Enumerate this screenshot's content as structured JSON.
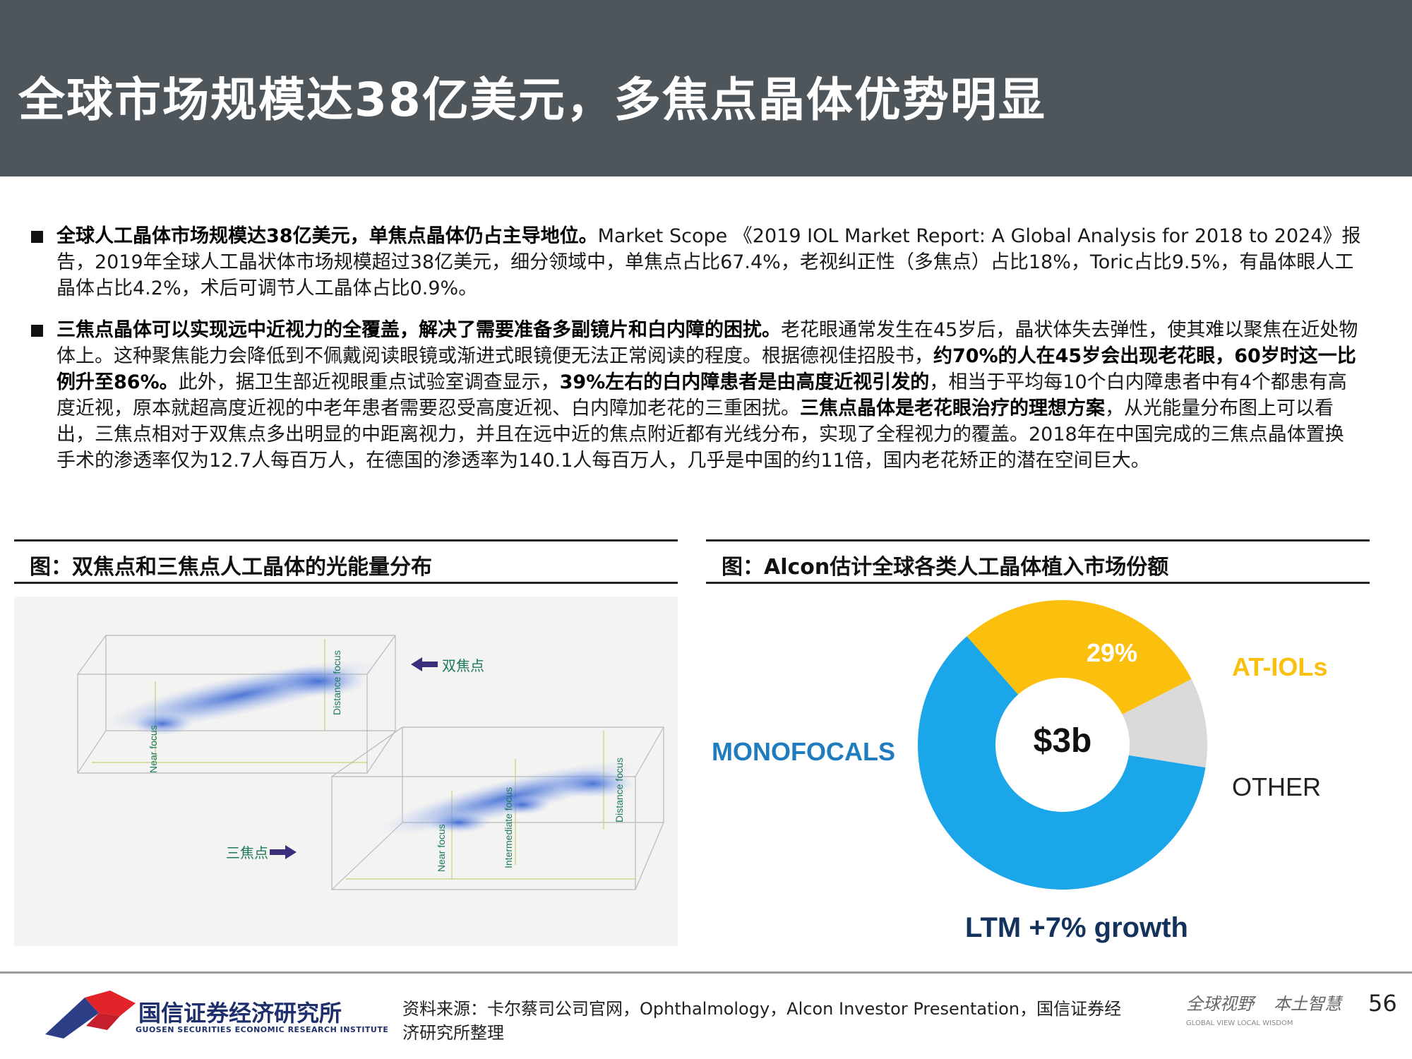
{
  "header": {
    "title": "全球市场规模达38亿美元，多焦点晶体优势明显"
  },
  "bullets": [
    {
      "bold1": "全球人工晶体市场规模达38亿美元，单焦点晶体仍占主导地位。",
      "text1": "Market Scope 《2019 IOL Market Report: A Global Analysis for 2018 to 2024》报告，2019年全球人工晶状体市场规模超过38亿美元，细分领域中，单焦点占比67.4%，老视纠正性（多焦点）占比18%，Toric占比9.5%，有晶体眼人工晶体占比4.2%，术后可调节人工晶体占比0.9%。"
    },
    {
      "bold1": "三焦点晶体可以实现远中近视力的全覆盖，解决了需要准备多副镜片和白内障的困扰。",
      "text1": "老花眼通常发生在45岁后，晶状体失去弹性，使其难以聚焦在近处物体上。这种聚焦能力会降低到不佩戴阅读眼镜或渐进式眼镜便无法正常阅读的程度。根据德视佳招股书，",
      "bold2": "约70%的人在45岁会出现老花眼，60岁时这一比例升至86%。",
      "text2": "此外，据卫生部近视眼重点试验室调查显示，",
      "bold3": "39%左右的白内障患者是由高度近视引发的",
      "text3": "，相当于平均每10个白内障患者中有4个都患有高度近视，原本就超高度近视的中老年患者需要忍受高度近视、白内障加老花的三重困扰。",
      "bold4": "三焦点晶体是老花眼治疗的理想方案",
      "text4": "，从光能量分布图上可以看出，三焦点相对于双焦点多出明显的中距离视力，并且在远中近的焦点附近都有光线分布，实现了全程视力的覆盖。2018年在中国完成的三焦点晶体置换手术的渗透率仅为12.7人每百万人，在德国的渗透率为140.1人每百万人，几乎是中国的约11倍，国内老花矫正的潜在空间巨大。"
    }
  ],
  "figure_left": {
    "caption": "图：双焦点和三焦点人工晶体的光能量分布",
    "label_bifocal": "双焦点",
    "label_trifocal": "三焦点",
    "axis_near_1": "Near focus",
    "axis_distance_1": "Distance focus",
    "axis_near_2": "Near focus",
    "axis_intermediate_2": "Intermediate focus",
    "axis_distance_2": "Distance focus",
    "colors": {
      "beam": "#2f5fd0",
      "accent": "#1e7a5c",
      "arrow": "#3a2f7a"
    }
  },
  "figure_right": {
    "caption": "图：Alcon估计全球各类人工晶体植入市场份额",
    "center_label": "$3b",
    "pct_label": "29%",
    "growth_label": "LTM +7% growth",
    "colors": {
      "monofocals": "#1aa6e8",
      "at_iols": "#fbbf0d",
      "other": "#d9d9d9",
      "dark": "#13325c"
    }
  },
  "chart_data": {
    "type": "pie",
    "variant": "donut",
    "title": "",
    "center_text": "$3b",
    "slices": [
      {
        "label": "AT-IOLs",
        "value": 29,
        "color": "#fbbf0d"
      },
      {
        "label": "OTHER",
        "value": 10,
        "color": "#d9d9d9"
      },
      {
        "label": "MONOFOCALS",
        "value": 61,
        "color": "#1aa6e8"
      }
    ],
    "annotation": "LTM +7% growth"
  },
  "footer": {
    "logo_cn": "国信证券经济研究所",
    "logo_en": "GUOSEN SECURITIES ECONOMIC RESEARCH INSTITUTE",
    "source": "资料来源：卡尔蔡司公司官网，Ophthalmology，Alcon Investor Presentation，国信证券经济研究所整理",
    "slogan_1": "全球视野",
    "slogan_2": "本土智慧",
    "slogan_en": "GLOBAL VIEW  LOCAL WISDOM",
    "page": "56"
  }
}
